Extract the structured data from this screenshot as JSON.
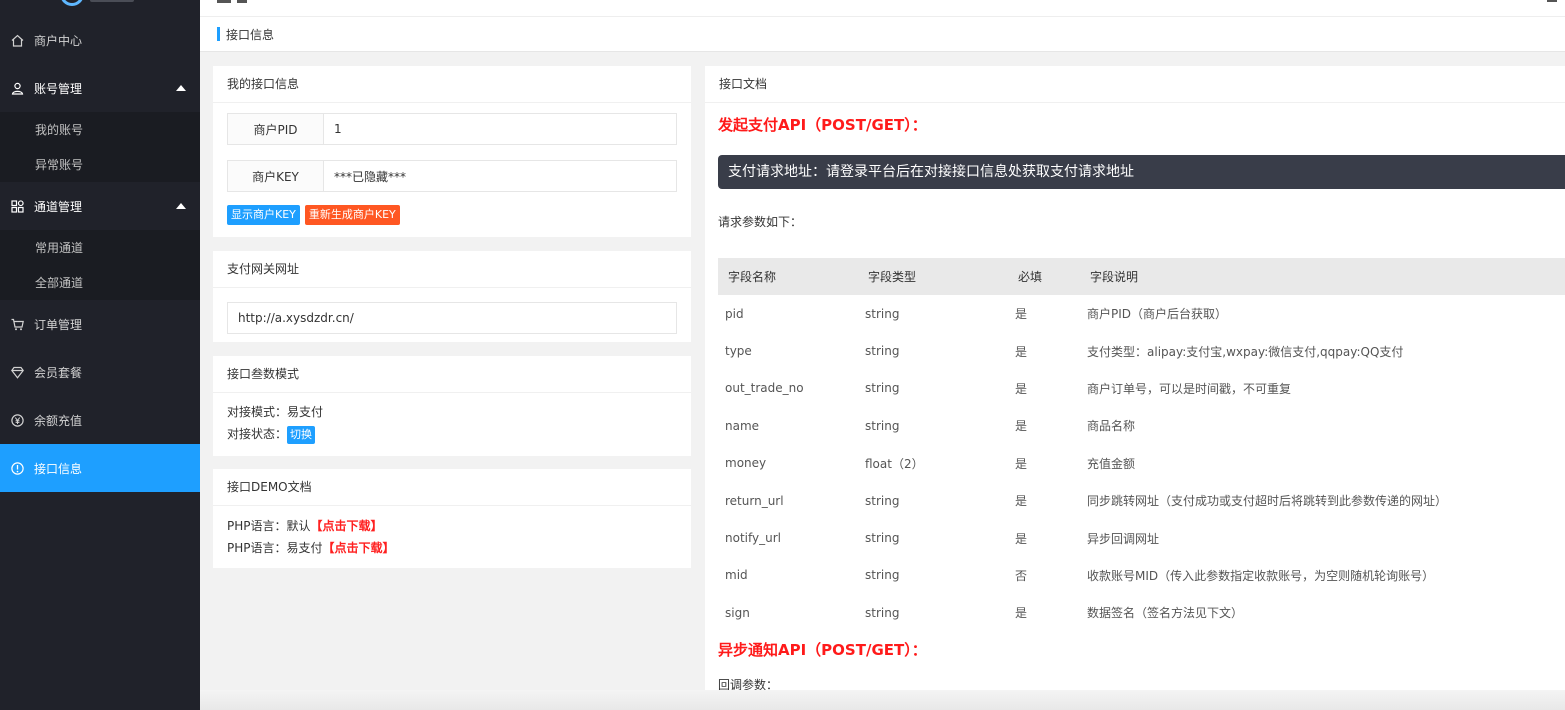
{
  "sidebar": {
    "items": [
      {
        "label": "商户中心",
        "icon": "home-icon"
      },
      {
        "label": "账号管理",
        "icon": "user-icon",
        "children": [
          "我的账号",
          "异常账号"
        ]
      },
      {
        "label": "通道管理",
        "icon": "apps-icon",
        "children": [
          "常用通道",
          "全部通道"
        ]
      },
      {
        "label": "订单管理",
        "icon": "cart-icon"
      },
      {
        "label": "会员套餐",
        "icon": "diamond-icon"
      },
      {
        "label": "余额充值",
        "icon": "yen-icon"
      },
      {
        "label": "接口信息",
        "icon": "info-icon",
        "active": true
      }
    ]
  },
  "breadcrumb": {
    "label": "接口信息"
  },
  "my_api": {
    "title": "我的接口信息",
    "pid_label": "商户PID",
    "pid_value": "1",
    "key_label": "商户KEY",
    "key_value": "***已隐藏***",
    "show_key_button": "显示商户KEY",
    "reset_key_button": "重新生成商户KEY"
  },
  "gateway": {
    "title": "支付网关网址",
    "url": "http://a.xysdzdr.cn/"
  },
  "param_mode": {
    "title": "接口叁数模式",
    "mode_line": "对接模式：易支付",
    "status_label": "对接状态：",
    "switch_button": "切换"
  },
  "demo": {
    "title": "接口DEMO文档",
    "line1_prefix": "PHP语言：默认",
    "line1_link": "【点击下载】",
    "line2_prefix": "PHP语言：易支付",
    "line2_link": "【点击下载】"
  },
  "doc": {
    "title": "接口文档",
    "api1_heading": "发起支付API（POST/GET）：",
    "request_url_text": "支付请求地址：请登录平台后在对接接口信息处获取支付请求地址",
    "params_intro": "请求参数如下：",
    "columns": [
      "字段名称",
      "字段类型",
      "必填",
      "字段说明"
    ],
    "rows": [
      [
        "pid",
        "string",
        "是",
        "商户PID（商户后台获取）"
      ],
      [
        "type",
        "string",
        "是",
        "支付类型：alipay:支付宝,wxpay:微信支付,qqpay:QQ支付"
      ],
      [
        "out_trade_no",
        "string",
        "是",
        "商户订单号，可以是时间戳，不可重复"
      ],
      [
        "name",
        "string",
        "是",
        "商品名称"
      ],
      [
        "money",
        "float（2）",
        "是",
        "充值金额"
      ],
      [
        "return_url",
        "string",
        "是",
        "同步跳转网址（支付成功或支付超时后将跳转到此参数传递的网址）"
      ],
      [
        "notify_url",
        "string",
        "是",
        "异步回调网址"
      ],
      [
        "mid",
        "string",
        "否",
        "收款账号MID（传入此参数指定收款账号，为空则随机轮询账号）"
      ],
      [
        "sign",
        "string",
        "是",
        "数据签名（签名方法见下文）"
      ]
    ],
    "api2_heading": "异步通知API（POST/GET）：",
    "callback_params": "回调参数："
  }
}
